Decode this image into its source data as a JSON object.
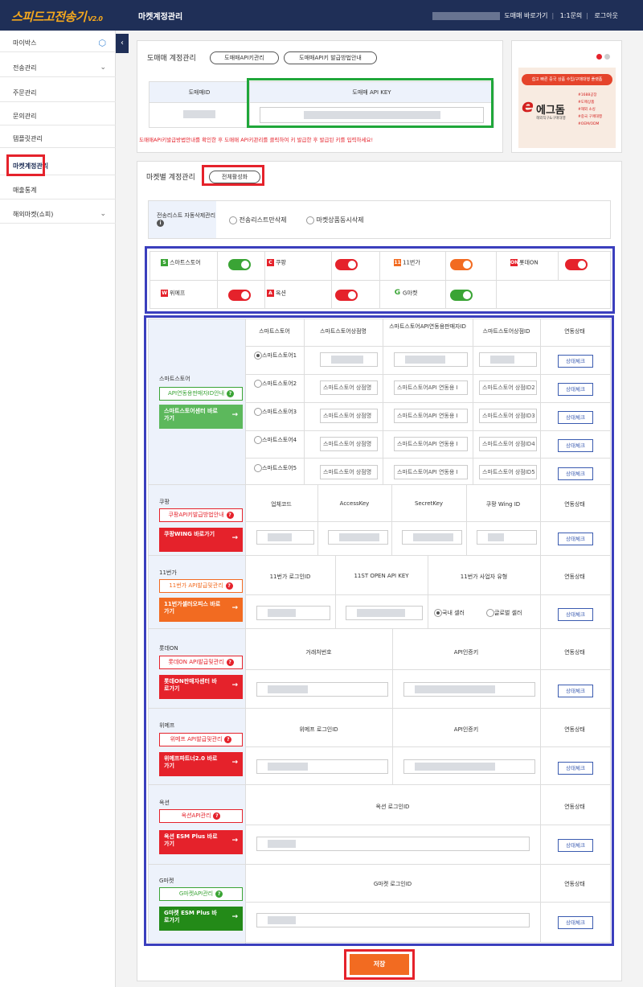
{
  "header": {
    "logo": "스피드고전송기",
    "version": "V2.0",
    "title": "마켓계정관리",
    "links": [
      "도매매 바로가기",
      "1:1문의",
      "로그아웃"
    ]
  },
  "sidebar": {
    "items": [
      {
        "label": "마이박스",
        "icon": "cube-icon"
      },
      {
        "label": "전송관리",
        "icon": "chevron-down-icon"
      },
      {
        "label": "주문관리"
      },
      {
        "label": "문의관리"
      },
      {
        "label": "템플릿관리"
      },
      {
        "label": "마켓계정관리"
      },
      {
        "label": "매출통계"
      },
      {
        "label": "해외마켓(쇼피)",
        "icon": "chevron-down-icon"
      }
    ]
  },
  "domeme": {
    "title": "도매매 계정관리",
    "btn_api": "도매매API키관리",
    "btn_guide": "도매매API키 발급방법안내",
    "col_id": "도매매ID",
    "col_key": "도매매 API KEY",
    "notice": "도매매API키발급방법안내를 확인한 후 도매매 API키관리를 클릭하여 키 발급한 후 발급된 키를 입력하세요!"
  },
  "banner": {
    "tagline": "쉽고 빠른 중국 상품 수입/구매대행 플랫폼",
    "brand": "에그돔",
    "brand_sub": "해외직구&구매대행",
    "bullets": [
      "#1688공장",
      "#도매상품",
      "#해외 소싱",
      "#중국 구매대행",
      "#OEM/ODM"
    ]
  },
  "market": {
    "title": "마켓별 계정관리",
    "btn_activate_all": "전체활성화",
    "auto_delete_label": "전송리스트 자동삭제관리",
    "opt_send_delete": "전송리스트만삭제",
    "opt_market_delete": "마켓상품동시삭제"
  },
  "toggles": [
    {
      "name": "스마트스토어",
      "icon": "S",
      "color": "#3aa435",
      "on": true
    },
    {
      "name": "쿠팡",
      "icon": "C",
      "color": "#e5222b",
      "on": false
    },
    {
      "name": "11번가",
      "icon": "11",
      "color": "#f26b21",
      "on": false
    },
    {
      "name": "롯데ON",
      "icon": "ON",
      "color": "#e5222b",
      "on": false
    },
    {
      "name": "위메프",
      "icon": "W",
      "color": "#e5222b",
      "on": false
    },
    {
      "name": "옥션",
      "icon": "A",
      "color": "#e5222b",
      "on": false
    },
    {
      "name": "G마켓",
      "icon": "G",
      "color": "#3aa435",
      "on": true
    }
  ],
  "smartstore": {
    "title": "스마트스토어",
    "api_btn": "API연동용판매자ID안내",
    "go_btn": "스마트스토어센터 바로가기",
    "cols": [
      "스마트스토어",
      "스마트스토어상점명",
      "스마트스토어API연동용판매자ID",
      "스마트스토어상점ID",
      "연동상태"
    ],
    "rows": [
      {
        "label": "스마트스토어1",
        "shop": "",
        "api": "",
        "sid": ""
      },
      {
        "label": "스마트스토어2",
        "shop": "스마트스토어 상점명",
        "api": "스마트스토어API 연동용 I",
        "sid": "스마트스토어 상점ID2"
      },
      {
        "label": "스마트스토어3",
        "shop": "스마트스토어 상점명",
        "api": "스마트스토어API 연동용 I",
        "sid": "스마트스토어 상점ID3"
      },
      {
        "label": "스마트스토어4",
        "shop": "스마트스토어 상점명",
        "api": "스마트스토어API 연동용 I",
        "sid": "스마트스토어 상점ID4"
      },
      {
        "label": "스마트스토어5",
        "shop": "스마트스토어 상점명",
        "api": "스마트스토어API 연동용 I",
        "sid": "스마트스토어 상점ID5"
      }
    ]
  },
  "coupang": {
    "title": "쿠팡",
    "api_btn": "쿠팡API키발급방법안내",
    "go_btn": "쿠팡WING 바로가기",
    "cols": [
      "업체코드",
      "AccessKey",
      "SecretKey",
      "쿠팡 Wing ID",
      "연동상태"
    ]
  },
  "st11": {
    "title": "11번가",
    "api_btn": "11번가 API발급및관리",
    "go_btn": "11번가셀러오피스 바로가기",
    "cols": [
      "11번가 로그인ID",
      "11ST OPEN API KEY",
      "11번가 사업자 유형",
      "연동상태"
    ],
    "opt_domestic": "국내 셀러",
    "opt_global": "글로벌 셀러"
  },
  "lotte": {
    "title": "롯데ON",
    "api_btn": "롯데ON API발급및관리",
    "go_btn": "롯데ON판매자센터 바로가기",
    "cols": [
      "거래처번호",
      "API인증키",
      "연동상태"
    ]
  },
  "wemake": {
    "title": "위메프",
    "api_btn": "위메프 API발급및관리",
    "go_btn": "위메프파트너2.0 바로가기",
    "cols": [
      "위메프 로그인ID",
      "API인증키",
      "연동상태"
    ]
  },
  "auction": {
    "title": "옥션",
    "api_btn": "옥션API관리",
    "go_btn": "옥션 ESM Plus 바로가기",
    "cols": [
      "옥션 로그인ID",
      "연동상태"
    ]
  },
  "gmarket": {
    "title": "G마켓",
    "api_btn": "G마켓API관리",
    "go_btn": "G마켓 ESM Plus 바로가기",
    "cols": [
      "G마켓 로그인ID",
      "연동상태"
    ]
  },
  "status_check": "상태체크",
  "save": "저장"
}
